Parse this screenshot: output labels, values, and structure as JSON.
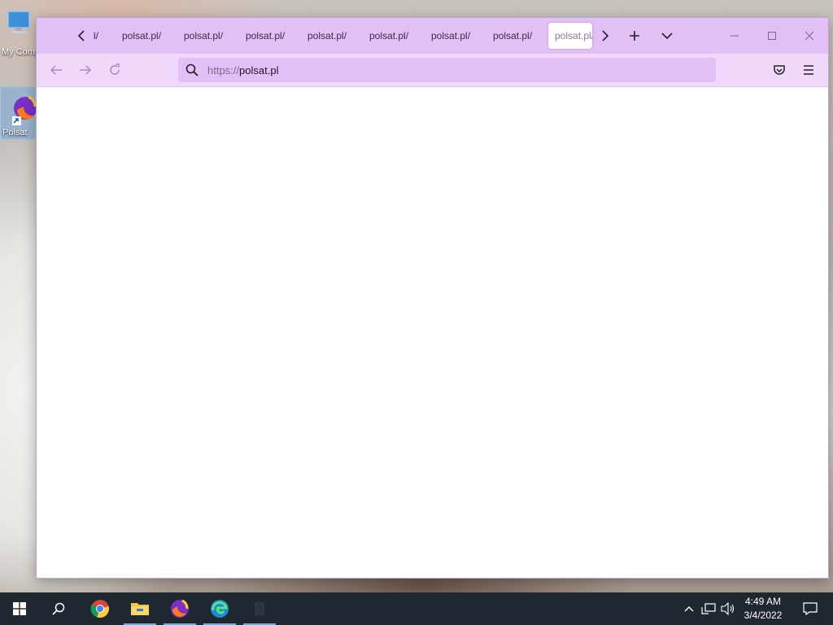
{
  "desktop": {
    "icons": [
      {
        "label": "My Computer",
        "icon": "computer-icon"
      },
      {
        "label": "Polsat",
        "icon": "firefox-shortcut-icon"
      }
    ]
  },
  "browser": {
    "tabs": {
      "partial_label": "l/",
      "items": [
        {
          "label": "polsat.pl/"
        },
        {
          "label": "polsat.pl/"
        },
        {
          "label": "polsat.pl/"
        },
        {
          "label": "polsat.pl/"
        },
        {
          "label": "polsat.pl/"
        },
        {
          "label": "polsat.pl/"
        },
        {
          "label": "polsat.pl/"
        },
        {
          "label": "polsat.pl/",
          "active": true
        }
      ]
    },
    "urlbar": {
      "scheme": "https://",
      "host": "polsat.pl"
    },
    "colors": {
      "tabbar_bg": "#e2bff6",
      "navbar_bg": "#f0d8fb",
      "urlbar_bg": "#e2bff6"
    }
  },
  "taskbar": {
    "apps": [
      "start-icon",
      "search-icon",
      "chrome-icon",
      "file-explorer-icon",
      "firefox-icon",
      "edge-icon",
      "blank-app-icon"
    ],
    "clock": {
      "time": "4:49 AM",
      "date": "3/4/2022"
    }
  }
}
